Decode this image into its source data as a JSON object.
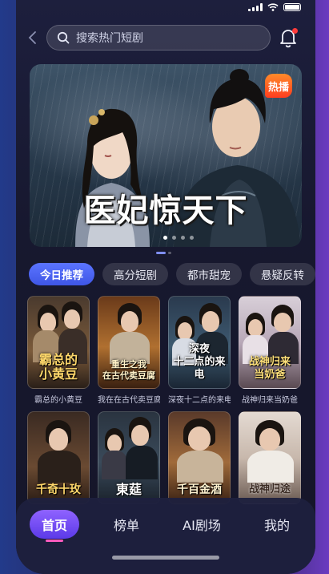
{
  "search": {
    "placeholder": "搜索热门短剧"
  },
  "banner": {
    "title": "医妃惊天下",
    "badge": "热播",
    "dots": 4,
    "active_dot": 1
  },
  "tabs": [
    {
      "label": "今日推荐",
      "active": true
    },
    {
      "label": "高分短剧",
      "active": false
    },
    {
      "label": "都市甜宠",
      "active": false
    },
    {
      "label": "悬疑反转",
      "active": false
    }
  ],
  "dramas": [
    {
      "poster_title": "霸总的\n小黄豆",
      "label": "霸总的小黄豆"
    },
    {
      "poster_title": "重生之我\n在古代卖豆腐",
      "label": "我在在古代卖豆腐"
    },
    {
      "poster_title": "深夜\n十二点的来电",
      "label": "深夜十二点的来电"
    },
    {
      "poster_title": "战神归来\n当奶爸",
      "label": "战神归来当奶爸"
    },
    {
      "poster_title": "千奇十玫",
      "label": ""
    },
    {
      "poster_title": "東莚",
      "label": ""
    },
    {
      "poster_title": "千百金酒",
      "label": ""
    },
    {
      "poster_title": "战神归途",
      "label": ""
    }
  ],
  "nav": [
    {
      "label": "首页",
      "active": true
    },
    {
      "label": "榜单",
      "active": false
    },
    {
      "label": "AI剧场",
      "active": false
    },
    {
      "label": "我的",
      "active": false
    }
  ],
  "colors": {
    "accent": "#4f66f5",
    "nav_active": "#7a50f5",
    "notify": "#ff3b3b",
    "badge": "#ff5a24"
  }
}
